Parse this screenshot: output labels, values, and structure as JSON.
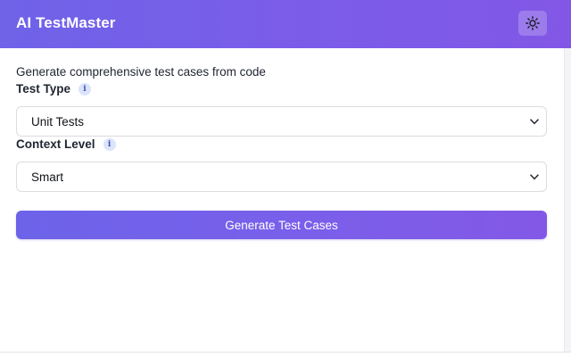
{
  "header": {
    "title": "AI TestMaster",
    "theme_toggle_icon": "sun-icon"
  },
  "main": {
    "subtitle": "Generate comprehensive test cases from code",
    "test_type": {
      "label": "Test Type",
      "info_icon": "i",
      "selected": "Unit Tests"
    },
    "context_level": {
      "label": "Context Level",
      "info_icon": "i",
      "selected": "Smart"
    },
    "generate_button_label": "Generate Test Cases"
  },
  "colors": {
    "header_gradient_start": "#6f63e8",
    "header_gradient_end": "#8257e6",
    "button_gradient_start": "#6c63e9",
    "button_gradient_end": "#8358e6",
    "info_badge_bg": "#dbe4fb"
  }
}
